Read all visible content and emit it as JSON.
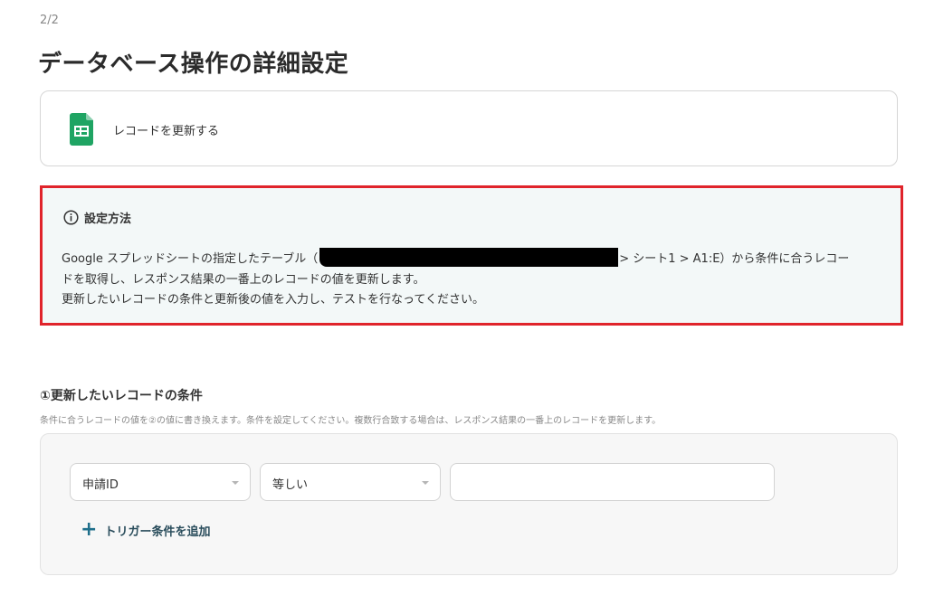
{
  "step": "2/2",
  "page_title": "データベース操作の詳細設定",
  "action": {
    "label": "レコードを更新する",
    "icon": "google-sheets-icon"
  },
  "info": {
    "title": "設定方法",
    "line1_prefix": "Google スプレッドシートの指定したテーブル（",
    "line1_suffix": "> シート1 > A1:E）から条件に合うレコー",
    "line2": "ドを取得し、レスポンス結果の一番上のレコードの値を更新します。",
    "line3": "更新したいレコードの条件と更新後の値を入力し、テストを行なってください。"
  },
  "condition_section": {
    "title": "①更新したいレコードの条件",
    "description": "条件に合うレコードの値を②の値に書き換えます。条件を設定してください。複数行合致する場合は、レスポンス結果の一番上のレコードを更新します。",
    "field_select": "申請ID",
    "operator_select": "等しい",
    "value_input": "",
    "add_trigger_label": "トリガー条件を追加"
  },
  "colors": {
    "highlight_border": "#e0242b",
    "info_background": "#f3f8f8",
    "sheets_green": "#1fa463",
    "accent": "#1f6f8b"
  }
}
